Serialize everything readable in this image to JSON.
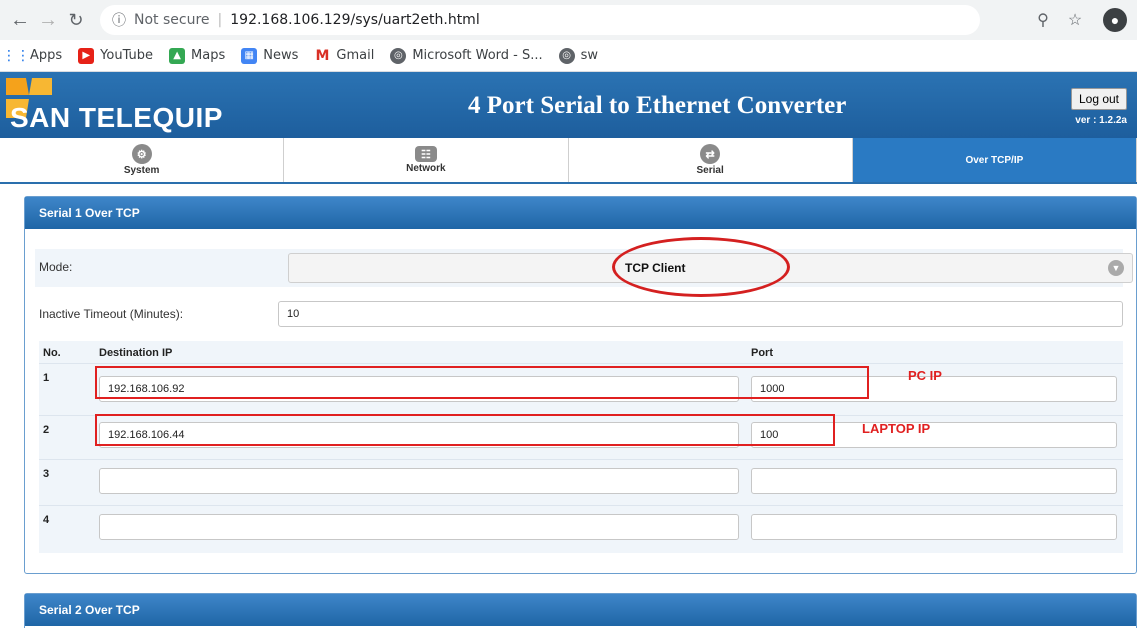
{
  "browser": {
    "security_label": "Not secure",
    "url": "192.168.106.129/sys/uart2eth.html",
    "bookmarks": [
      {
        "label": "Apps"
      },
      {
        "label": "YouTube"
      },
      {
        "label": "Maps"
      },
      {
        "label": "News"
      },
      {
        "label": "Gmail"
      },
      {
        "label": "Microsoft Word - S..."
      },
      {
        "label": "sw"
      }
    ]
  },
  "header": {
    "brand": "SAN TELEQUIP",
    "title": "4 Port Serial to Ethernet Converter",
    "logout_label": "Log out",
    "version": "ver : 1.2.2a"
  },
  "tabs": [
    {
      "label": "System",
      "icon": "gear-icon",
      "active": false
    },
    {
      "label": "Network",
      "icon": "network-icon",
      "active": false
    },
    {
      "label": "Serial",
      "icon": "serial-icon",
      "active": false
    },
    {
      "label": "Over TCP/IP",
      "icon": "",
      "active": true
    }
  ],
  "serial1": {
    "title": "Serial 1 Over TCP",
    "mode_label": "Mode:",
    "mode_value": "TCP Client",
    "timeout_label": "Inactive Timeout (Minutes):",
    "timeout_value": "10",
    "col_no": "No.",
    "col_ip": "Destination IP",
    "col_port": "Port",
    "rows": [
      {
        "no": "1",
        "ip": "192.168.106.92",
        "port": "1000"
      },
      {
        "no": "2",
        "ip": "192.168.106.44",
        "port": "100"
      },
      {
        "no": "3",
        "ip": "",
        "port": ""
      },
      {
        "no": "4",
        "ip": "",
        "port": ""
      }
    ]
  },
  "annotations": {
    "pc_ip": "PC IP",
    "laptop_ip": "LAPTOP IP"
  },
  "serial2": {
    "title": "Serial 2 Over TCP"
  },
  "colors": {
    "header_blue": "#2b73b3",
    "active_tab": "#2a7ac3",
    "annotation_red": "#e02020",
    "logo_orange": "#f5a21b"
  }
}
